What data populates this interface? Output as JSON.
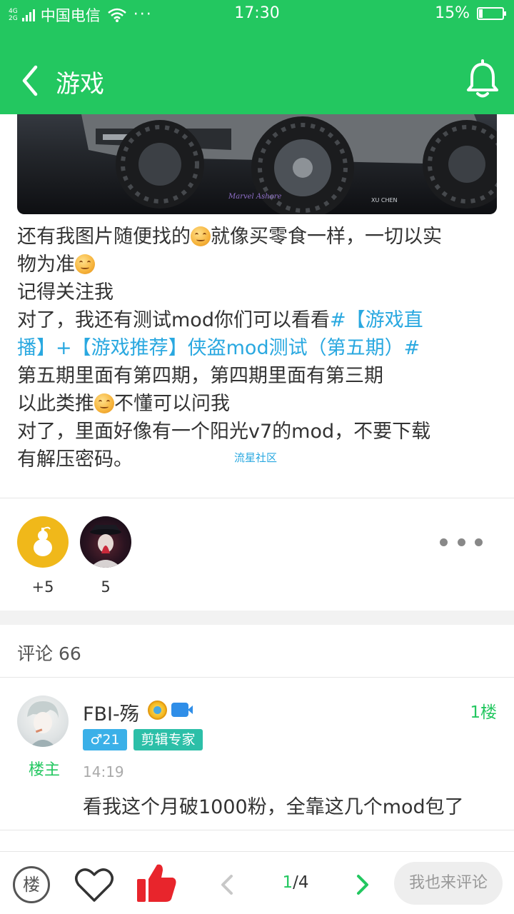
{
  "status_bar": {
    "network_type_top": "4G",
    "network_type_bottom": "2G",
    "carrier": "中国电信",
    "more": "···",
    "time": "17:30",
    "battery_percent": "15%",
    "battery_level": 0.15
  },
  "header": {
    "title": "游戏",
    "back_icon": "chevron-left-icon",
    "notification_icon": "bell-icon"
  },
  "post": {
    "image_watermarks": [
      "Marvel Ashore",
      "XU CHEN"
    ],
    "lines": [
      {
        "text": "还有我图片随便找的",
        "emoji_after": true,
        "rest": "就像买零食一样，一切以实"
      },
      {
        "text": "物为准",
        "emoji_after": true,
        "rest": ""
      },
      {
        "text": "记得关注我"
      },
      {
        "plain": "对了，我还有测试mod你们可以看看",
        "topic": "#【游戏直"
      },
      {
        "topic": "播】+【游戏推荐】侠盗mod测试（第五期）#"
      },
      {
        "text": "第五期里面有第四期，第四期里面有第三期"
      },
      {
        "text": "以此类推",
        "emoji_after": true,
        "rest": "不懂可以问我"
      },
      {
        "text": "对了，里面好像有一个阳光v7的mod，不要下载"
      },
      {
        "text": " 有解压密码。"
      }
    ],
    "source_tag": "流星社区"
  },
  "likes": {
    "items": [
      {
        "count": "+5"
      },
      {
        "count": "5"
      }
    ],
    "more_icon": "more-dots-icon"
  },
  "comments": {
    "header": "评论 66",
    "items": [
      {
        "username": "FBI-殇",
        "op_label": "楼主",
        "floor": "1楼",
        "gender_badge": "♂21",
        "title_badge": "剪辑专家",
        "time": "14:19",
        "text": "看我这个月破1000粉，全靠这几个mod包了"
      }
    ]
  },
  "bottom_bar": {
    "floor_label": "楼",
    "page_current": "1",
    "page_total": "/4",
    "comment_placeholder": "我也来评论",
    "colors": {
      "accent": "#23c760",
      "like": "#e8252c"
    }
  }
}
